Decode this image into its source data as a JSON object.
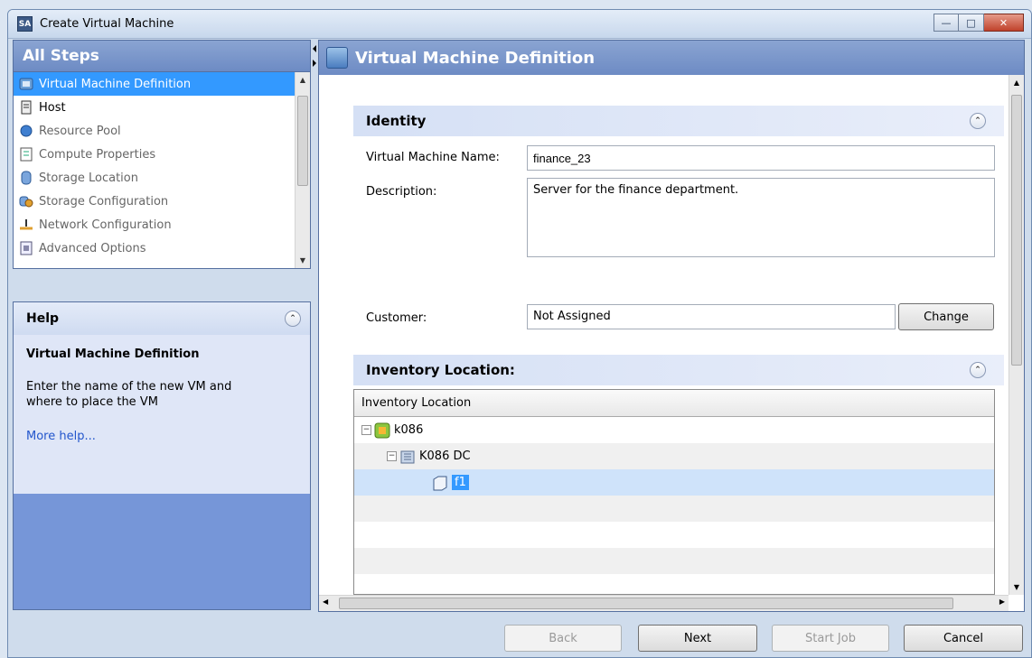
{
  "window": {
    "title": "Create Virtual Machine",
    "icon_text": "SA",
    "controls": [
      "minimize-icon",
      "maximize-icon",
      "close-icon"
    ]
  },
  "steps": {
    "header": "All Steps",
    "items": [
      {
        "label": "Virtual Machine Definition",
        "icon": "vm-icon",
        "state": "active"
      },
      {
        "label": "Host",
        "icon": "host-icon",
        "state": "enabled"
      },
      {
        "label": "Resource Pool",
        "icon": "resource-pool-icon",
        "state": "disabled"
      },
      {
        "label": "Compute Properties",
        "icon": "compute-icon",
        "state": "disabled"
      },
      {
        "label": "Storage Location",
        "icon": "storage-icon",
        "state": "disabled"
      },
      {
        "label": "Storage Configuration",
        "icon": "storage-config-icon",
        "state": "disabled"
      },
      {
        "label": "Network Configuration",
        "icon": "network-icon",
        "state": "disabled"
      },
      {
        "label": "Advanced Options",
        "icon": "advanced-icon",
        "state": "disabled"
      }
    ]
  },
  "help": {
    "header": "Help",
    "title": "Virtual Machine Definition",
    "text": "Enter the name of the new VM and where to place the VM",
    "link": "More help..."
  },
  "main": {
    "header": "Virtual Machine Definition",
    "identity": {
      "header": "Identity",
      "name_label": "Virtual Machine Name:",
      "name_value": "finance_23",
      "description_label": "Description:",
      "description_value": "Server for the finance department.",
      "customer_label": "Customer:",
      "customer_value": "Not Assigned",
      "change_button": "Change"
    },
    "inventory": {
      "header": "Inventory Location:",
      "column": "Inventory Location",
      "nodes": [
        {
          "label": "k086",
          "icon": "vcenter-icon",
          "level": 0,
          "expanded": true,
          "selected": false
        },
        {
          "label": "K086 DC",
          "icon": "datacenter-icon",
          "level": 1,
          "expanded": true,
          "selected": false
        },
        {
          "label": "f1",
          "icon": "folder-icon",
          "level": 2,
          "expanded": false,
          "selected": true
        }
      ]
    }
  },
  "footer": {
    "back": "Back",
    "next": "Next",
    "start_job": "Start Job",
    "cancel": "Cancel"
  },
  "colors": {
    "header_blue": "#7696d8",
    "selection": "#3399ff"
  }
}
